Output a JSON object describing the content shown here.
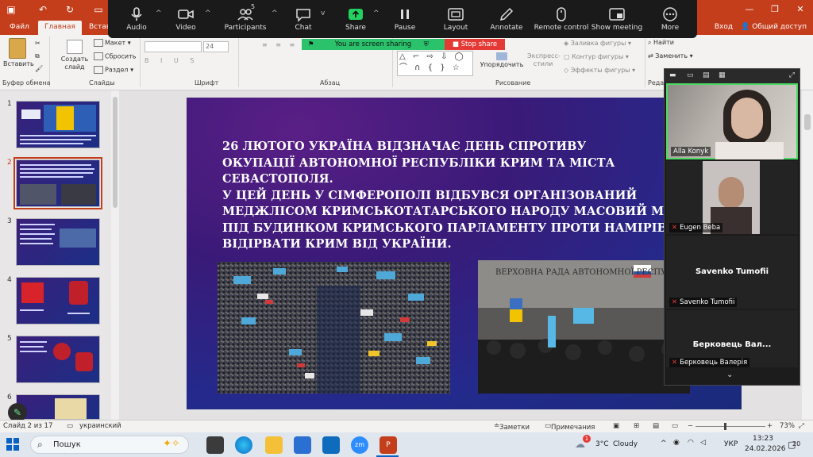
{
  "ribbon": {
    "tabs": [
      "Файл",
      "Главная",
      "Вставка"
    ],
    "active_tab": "Главная",
    "login": "Вход",
    "share": "Общий доступ",
    "groups": {
      "clipboard": "Буфер обмена",
      "slides": "Слайды",
      "font": "Шрифт",
      "paragraph": "Абзац",
      "drawing": "Рисование",
      "editing": "Реда"
    },
    "buttons": {
      "paste": "Вставить",
      "new_slide": "Создать слайд",
      "layout": "Макет",
      "reset": "Сбросить",
      "section": "Раздел",
      "arrange": "Упорядочить",
      "quick_styles": "Экспресс-стили",
      "shape_fill": "Заливка фигуры",
      "shape_outline": "Контур фигуры",
      "shape_effects": "Эффекты фигуры",
      "find": "Найти",
      "replace": "Заменить"
    },
    "font_size": "24"
  },
  "zoom_toolbar": {
    "participants_count": "5",
    "buttons": [
      "Audio",
      "Video",
      "Participants",
      "Chat",
      "Share",
      "Pause",
      "Layout",
      "Annotate",
      "Remote control",
      "Show meeting",
      "More"
    ],
    "share_status": "You are screen sharing",
    "stop_share": "Stop share"
  },
  "thumbnails": [
    "1",
    "2",
    "3",
    "4",
    "5",
    "6"
  ],
  "selected_slide": "2",
  "slide": {
    "lines": [
      "26 ЛЮТОГО УКРАЇНА ВІДЗНАЧАЄ ДЕНЬ СПРОТИВУ",
      "ОКУПАЦІЇ АВТОНОМНОЇ РЕСПУБЛІКИ КРИМ ТА МІСТА",
      "СЕВАСТОПОЛЯ.",
      "У ЦЕЙ ДЕНЬ У СІМФЕРОПОЛІ ВІДБУВСЯ ОРГАНІЗОВАНИЙ",
      "МЕДЖЛІСОМ КРИМСЬКОТАТАРСЬКОГО НАРОДУ МАСОВИЙ М",
      "ПІД БУДИНКОМ КРИМСЬКОГО ПАРЛАМЕНТУ ПРОТИ НАМІРІВ",
      "ВІДІРВАТИ КРИМ ВІД УКРАЇНИ."
    ],
    "photo2_sign": "ВЕРХОВНА РАДА АВТОНОМНОЇ РЕСПУБЛІКИ КРИМ"
  },
  "participants": [
    {
      "name": "Alla Konyk",
      "type": "video"
    },
    {
      "name": "Eugen Beba",
      "type": "video"
    },
    {
      "name": "Savenko Tumofii",
      "display": "Savenko Tumofii",
      "type": "name"
    },
    {
      "name": "Берковець Валерія",
      "display": "Берковець  Вал...",
      "type": "name"
    }
  ],
  "statusbar": {
    "slide_info": "Слайд 2 из 17",
    "language": "украинский",
    "notes": "Заметки",
    "comments": "Примечания",
    "zoom": "73%"
  },
  "taskbar": {
    "search": "Пошук",
    "weather_temp": "3°C",
    "weather_text": "Cloudy",
    "weather_alert": "1",
    "lang": "УКР",
    "time": "13:23",
    "date": "24.02.2026",
    "notifications": "20"
  }
}
